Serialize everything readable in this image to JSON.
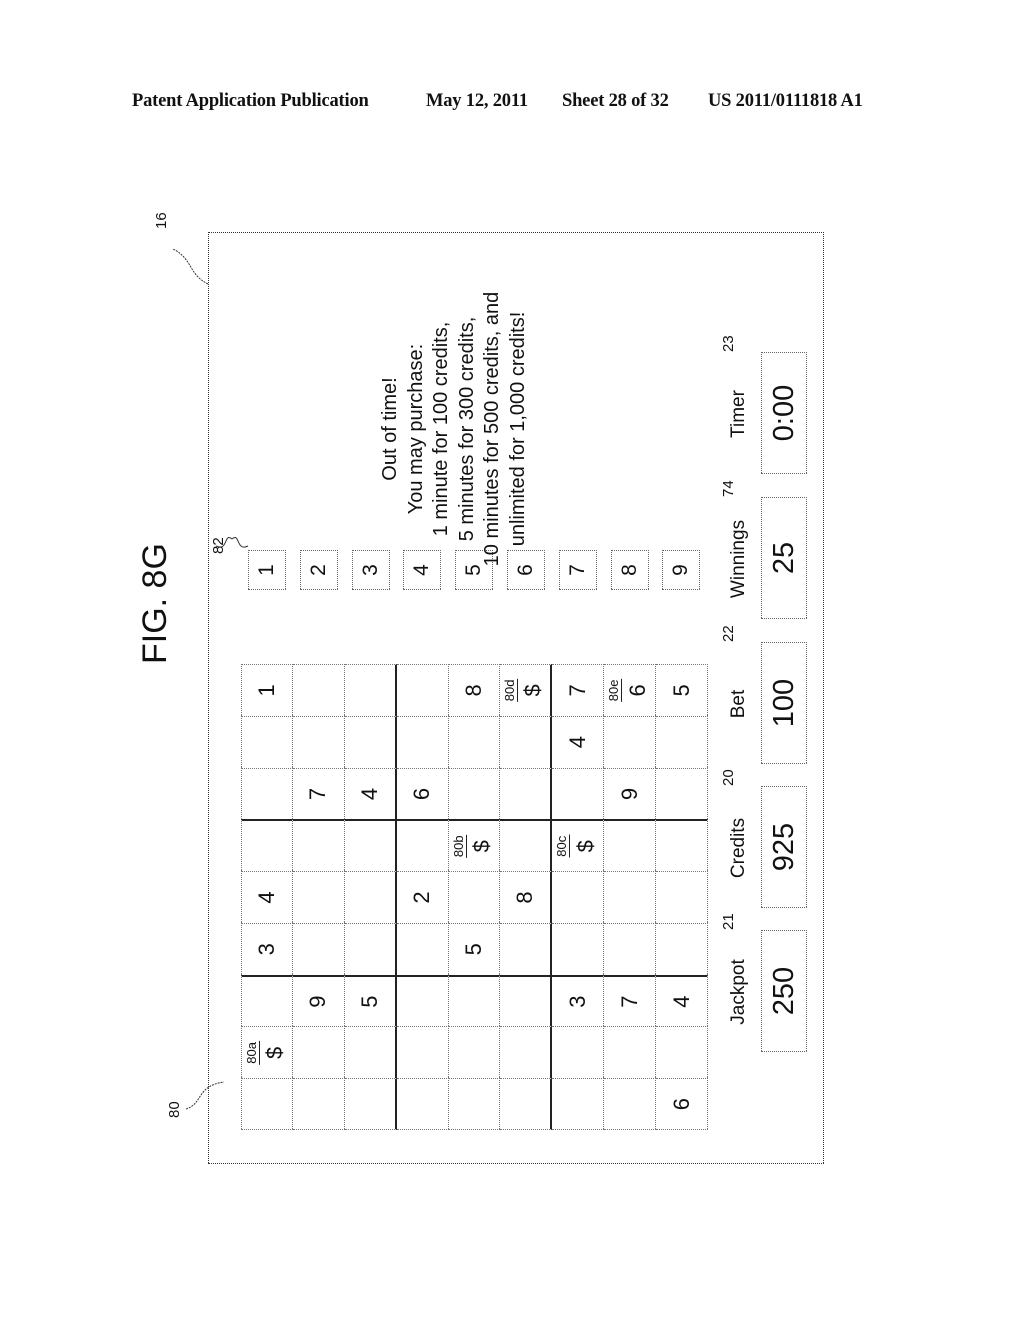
{
  "header": {
    "publication": "Patent Application Publication",
    "date": "May 12, 2011",
    "sheet": "Sheet 28 of 32",
    "number": "US 2011/0111818 A1"
  },
  "figure": {
    "label": "FIG. 8G",
    "refs": {
      "display": "16",
      "grid": "80",
      "number_buttons": "82",
      "credits": "20",
      "jackpot": "21",
      "bet": "22",
      "timer": "23",
      "winnings": "74"
    },
    "grid": [
      [
        "",
        "80a|$",
        "",
        "3",
        "4",
        "",
        "",
        "",
        "1"
      ],
      [
        "",
        "",
        "9",
        "",
        "",
        "",
        "7",
        "",
        ""
      ],
      [
        "",
        "",
        "5",
        "",
        "",
        "",
        "4",
        "",
        ""
      ],
      [
        "",
        "",
        "",
        "",
        "2",
        "",
        "6",
        "",
        ""
      ],
      [
        "",
        "",
        "",
        "5",
        "",
        "80b|$",
        "",
        "",
        "8"
      ],
      [
        "",
        "",
        "",
        "",
        "8",
        "",
        "",
        "",
        "80d|$"
      ],
      [
        "",
        "",
        "3",
        "",
        "",
        "80c|$",
        "",
        "4",
        "7"
      ],
      [
        "",
        "",
        "7",
        "",
        "",
        "",
        "9",
        "",
        "80e|6"
      ],
      [
        "6",
        "",
        "4",
        "",
        "",
        "",
        "",
        "",
        "5"
      ]
    ],
    "number_buttons": [
      "1",
      "2",
      "3",
      "4",
      "5",
      "6",
      "7",
      "8",
      "9"
    ],
    "message": [
      "Out of time!",
      "You may purchase:",
      "1 minute for 100 credits,",
      "5 minutes for 300 credits,",
      "10 minutes for 500 credits, and",
      "unlimited for 1,000 credits!"
    ],
    "stats": [
      {
        "label": "Jackpot",
        "value": "250"
      },
      {
        "label": "Credits",
        "value": "925"
      },
      {
        "label": "Bet",
        "value": "100"
      },
      {
        "label": "Winnings",
        "value": "25"
      },
      {
        "label": "Timer",
        "value": "0:00"
      }
    ]
  }
}
